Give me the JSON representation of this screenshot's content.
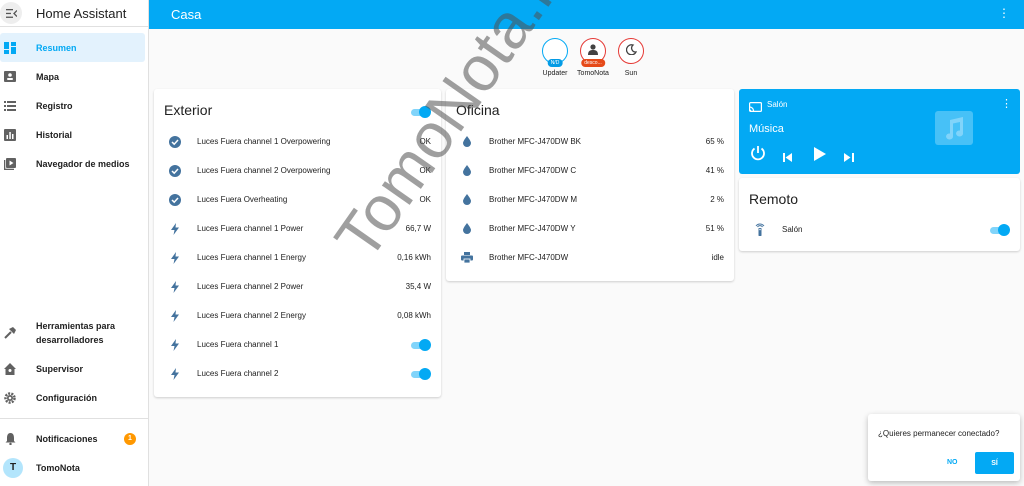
{
  "app": {
    "title": "Home Assistant"
  },
  "sidebar": {
    "items": [
      {
        "label": "Resumen",
        "icon": "dashboard-icon"
      },
      {
        "label": "Mapa",
        "icon": "map-icon"
      },
      {
        "label": "Registro",
        "icon": "logbook-icon"
      },
      {
        "label": "Historial",
        "icon": "history-chart-icon"
      },
      {
        "label": "Navegador de medios",
        "icon": "media-icon"
      }
    ],
    "bottom_items": [
      {
        "label": "Herramientas para desarrolladores",
        "icon": "hammer-icon"
      },
      {
        "label": "Supervisor",
        "icon": "home-assistant-icon"
      },
      {
        "label": "Configuración",
        "icon": "gear-icon"
      }
    ],
    "notifications": {
      "label": "Notificaciones",
      "count": "1"
    },
    "user": {
      "name": "TomoNota",
      "initial": "T"
    }
  },
  "header": {
    "title": "Casa"
  },
  "badges": [
    {
      "label": "Updater",
      "tag": "N/D"
    },
    {
      "label": "TomoNota",
      "tag": "desco..."
    },
    {
      "label": "Sun",
      "tag": ""
    }
  ],
  "exterior": {
    "title": "Exterior",
    "rows": [
      {
        "name": "Luces Fuera channel 1 Overpowering",
        "value": "OK"
      },
      {
        "name": "Luces Fuera channel 2 Overpowering",
        "value": "OK"
      },
      {
        "name": "Luces Fuera Overheating",
        "value": "OK"
      },
      {
        "name": "Luces Fuera channel 1 Power",
        "value": "66,7 W"
      },
      {
        "name": "Luces Fuera channel 1 Energy",
        "value": "0,16 kWh"
      },
      {
        "name": "Luces Fuera channel 2 Power",
        "value": "35,4 W"
      },
      {
        "name": "Luces Fuera channel 2 Energy",
        "value": "0,08 kWh"
      },
      {
        "name": "Luces Fuera channel 1",
        "value": ""
      },
      {
        "name": "Luces Fuera channel 2",
        "value": ""
      }
    ]
  },
  "oficina": {
    "title": "Oficina",
    "rows": [
      {
        "name": "Brother MFC-J470DW BK",
        "value": "65 %"
      },
      {
        "name": "Brother MFC-J470DW C",
        "value": "41 %"
      },
      {
        "name": "Brother MFC-J470DW M",
        "value": "2 %"
      },
      {
        "name": "Brother MFC-J470DW Y",
        "value": "51 %"
      },
      {
        "name": "Brother MFC-J470DW",
        "value": "idle"
      }
    ]
  },
  "media": {
    "device": "Salón",
    "app": "Música"
  },
  "remoto": {
    "title": "Remoto",
    "row": "Salón"
  },
  "dialog": {
    "question": "¿Quieres permanecer conectado?",
    "no": "NO",
    "yes": "SÍ"
  },
  "watermark": "TomoNota.net",
  "colors": {
    "primary": "#03a9f4",
    "check": "#44739e",
    "badge": "#ff9800"
  }
}
